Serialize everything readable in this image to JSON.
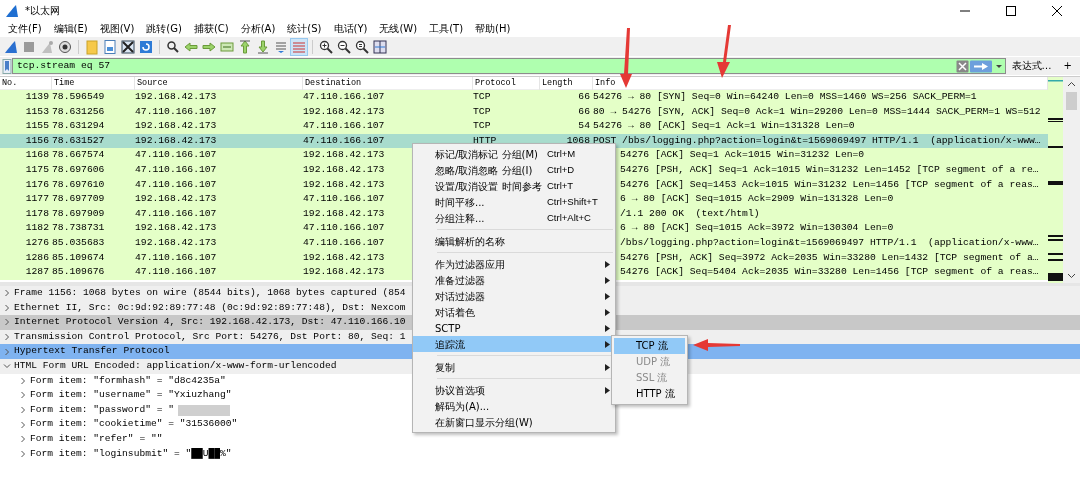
{
  "window": {
    "title": "*以太网"
  },
  "menubar": [
    "文件(F)",
    "编辑(E)",
    "视图(V)",
    "跳转(G)",
    "捕获(C)",
    "分析(A)",
    "统计(S)",
    "电话(Y)",
    "无线(W)",
    "工具(T)",
    "帮助(H)"
  ],
  "filter": {
    "value": "tcp.stream eq 57",
    "expression_label": "表达式…",
    "add_label": "+"
  },
  "packet_list": {
    "columns": [
      "No.",
      "Time",
      "Source",
      "Destination",
      "Protocol",
      "Length",
      "Info"
    ],
    "rows": [
      {
        "no": "1139",
        "time": "78.596549",
        "source": "192.168.42.173",
        "destination": "47.110.166.107",
        "protocol": "TCP",
        "length": "66",
        "info": "54276 → 80 [SYN] Seq=0 Win=64240 Len=0 MSS=1460 WS=256 SACK_PERM=1",
        "selected": false
      },
      {
        "no": "1153",
        "time": "78.631256",
        "source": "47.110.166.107",
        "destination": "192.168.42.173",
        "protocol": "TCP",
        "length": "66",
        "info": "80 → 54276 [SYN, ACK] Seq=0 Ack=1 Win=29200 Len=0 MSS=1444 SACK_PERM=1 WS=512",
        "selected": false
      },
      {
        "no": "1155",
        "time": "78.631294",
        "source": "192.168.42.173",
        "destination": "47.110.166.107",
        "protocol": "TCP",
        "length": "54",
        "info": "54276 → 80 [ACK] Seq=1 Ack=1 Win=131328 Len=0",
        "selected": false
      },
      {
        "no": "1156",
        "time": "78.631527",
        "source": "192.168.42.173",
        "destination": "47.110.166.107",
        "protocol": "HTTP",
        "length": "1068",
        "info": "POST /bbs/logging.php?action=login&t=1569069497 HTTP/1.1  (application/x-www…",
        "selected": true
      },
      {
        "no": "1168",
        "time": "78.667574",
        "source": "47.110.166.107",
        "destination": "192.168.42.173",
        "info": "54276 [ACK] Seq=1 Ack=1015 Win=31232 Len=0",
        "selected": false
      },
      {
        "no": "1175",
        "time": "78.697606",
        "source": "47.110.166.107",
        "destination": "192.168.42.173",
        "info": "54276 [PSH, ACK] Seq=1 Ack=1015 Win=31232 Len=1452 [TCP segment of a re…",
        "selected": false
      },
      {
        "no": "1176",
        "time": "78.697610",
        "source": "47.110.166.107",
        "destination": "192.168.42.173",
        "info": "54276 [ACK] Seq=1453 Ack=1015 Win=31232 Len=1456 [TCP segment of a reas…",
        "selected": false
      },
      {
        "no": "1177",
        "time": "78.697709",
        "source": "192.168.42.173",
        "destination": "47.110.166.107",
        "info": "6 → 80 [ACK] Seq=1015 Ack=2909 Win=131328 Len=0",
        "selected": false
      },
      {
        "no": "1178",
        "time": "78.697909",
        "source": "47.110.166.107",
        "destination": "192.168.42.173",
        "info": "/1.1 200 OK  (text/html)",
        "selected": false
      },
      {
        "no": "1182",
        "time": "78.738731",
        "source": "192.168.42.173",
        "destination": "47.110.166.107",
        "info": "6 → 80 [ACK] Seq=1015 Ack=3972 Win=130304 Len=0",
        "selected": false
      },
      {
        "no": "1276",
        "time": "85.035683",
        "source": "192.168.42.173",
        "destination": "47.110.166.107",
        "info": "/bbs/logging.php?action=login&t=1569069497 HTTP/1.1  (application/x-www…",
        "selected": false
      },
      {
        "no": "1286",
        "time": "85.109674",
        "source": "47.110.166.107",
        "destination": "192.168.42.173",
        "info": "54276 [PSH, ACK] Seq=3972 Ack=2035 Win=33280 Len=1432 [TCP segment of a…",
        "selected": false
      },
      {
        "no": "1287",
        "time": "85.109676",
        "source": "47.110.166.107",
        "destination": "192.168.42.173",
        "info": "54276 [ACK] Seq=5404 Ack=2035 Win=33280 Len=1456 [TCP segment of a reas…",
        "selected": false
      }
    ]
  },
  "details": [
    {
      "label": "Frame 1156: 1068 bytes on wire (8544 bits), 1068 bytes captured (854",
      "expanded": false,
      "selected": false,
      "hovered": false
    },
    {
      "label": "Ethernet II, Src: 0c:9d:92:89:77:48 (0c:9d:92:89:77:48), Dst: Nexcom",
      "expanded": false,
      "selected": false,
      "hovered": false
    },
    {
      "label": "Internet Protocol Version 4, Src: 192.168.42.173, Dst: 47.110.166.10",
      "expanded": false,
      "selected": false,
      "hovered": true
    },
    {
      "label": "Transmission Control Protocol, Src Port: 54276, Dst Port: 80, Seq: 1",
      "expanded": false,
      "selected": false,
      "hovered": false
    },
    {
      "label": "Hypertext Transfer Protocol",
      "expanded": false,
      "selected": true,
      "hovered": false
    },
    {
      "label": "HTML Form URL Encoded: application/x-www-form-urlencoded",
      "expanded": true,
      "selected": false,
      "hovered": false,
      "children": [
        {
          "label": "Form item: \"formhash\" = \"d8c4235a\"",
          "expanded": false,
          "selected": false,
          "hovered": false
        },
        {
          "label": "Form item: \"username\" = \"Yxiuzhang\"",
          "expanded": false,
          "selected": false,
          "hovered": false
        },
        {
          "label": "Form item: \"password\" = \"",
          "expanded": false,
          "selected": false,
          "hovered": false,
          "redacted": true
        },
        {
          "label": "Form item: \"cookietime\" = \"31536000\"",
          "expanded": false,
          "selected": false,
          "hovered": false
        },
        {
          "label": "Form item: \"refer\" = \"\"",
          "expanded": false,
          "selected": false,
          "hovered": false
        },
        {
          "label": "Form item: \"loginsubmit\" = \"██U██%\"",
          "expanded": false,
          "selected": false,
          "hovered": false
        }
      ]
    }
  ],
  "context_menu": [
    {
      "kind": "item",
      "label": "标记/取消标记 分组(M)",
      "shortcut": "Ctrl+M",
      "submenu": false,
      "selected": false
    },
    {
      "kind": "item",
      "label": "忽略/取消忽略 分组(I)",
      "shortcut": "Ctrl+D",
      "submenu": false,
      "selected": false
    },
    {
      "kind": "item",
      "label": "设置/取消设置 时间参考",
      "shortcut": "Ctrl+T",
      "submenu": false,
      "selected": false
    },
    {
      "kind": "item",
      "label": "时间平移...",
      "shortcut": "Ctrl+Shift+T",
      "submenu": false,
      "selected": false
    },
    {
      "kind": "item",
      "label": "分组注释...",
      "shortcut": "Ctrl+Alt+C",
      "submenu": false,
      "selected": false
    },
    {
      "kind": "separator"
    },
    {
      "kind": "item",
      "label": "编辑解析的名称",
      "submenu": false,
      "selected": false
    },
    {
      "kind": "separator"
    },
    {
      "kind": "item",
      "label": "作为过滤器应用",
      "submenu": true,
      "selected": false
    },
    {
      "kind": "item",
      "label": "准备过滤器",
      "submenu": true,
      "selected": false
    },
    {
      "kind": "item",
      "label": "对话过滤器",
      "submenu": true,
      "selected": false
    },
    {
      "kind": "item",
      "label": "对话着色",
      "submenu": true,
      "selected": false
    },
    {
      "kind": "item",
      "label": "SCTP",
      "submenu": true,
      "selected": false
    },
    {
      "kind": "item",
      "label": "追踪流",
      "submenu": true,
      "selected": true
    },
    {
      "kind": "separator"
    },
    {
      "kind": "item",
      "label": "复制",
      "submenu": true,
      "selected": false
    },
    {
      "kind": "separator"
    },
    {
      "kind": "item",
      "label": "协议首选项",
      "submenu": true,
      "selected": false
    },
    {
      "kind": "item",
      "label": "解码为(A)...",
      "submenu": false,
      "selected": false
    },
    {
      "kind": "item",
      "label": "在新窗口显示分组(W)",
      "submenu": false,
      "selected": false
    }
  ],
  "submenu": [
    {
      "label": "TCP 流",
      "selected": true,
      "disabled": false
    },
    {
      "label": "UDP 流",
      "selected": false,
      "disabled": true
    },
    {
      "label": "SSL 流",
      "selected": false,
      "disabled": true
    },
    {
      "label": "HTTP 流",
      "selected": false,
      "disabled": false
    }
  ]
}
